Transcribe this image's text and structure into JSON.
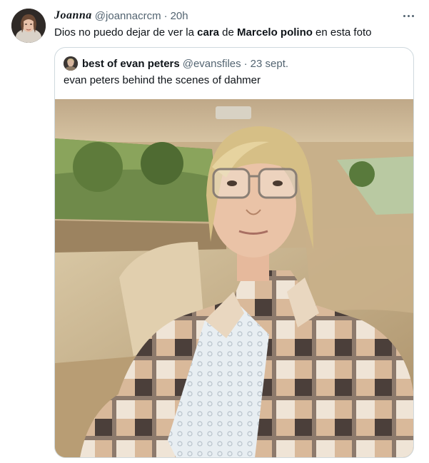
{
  "tweet": {
    "author_name": "Joanna",
    "author_handle": "@joannacrcm",
    "separator": "·",
    "time": "20h",
    "text_parts": [
      "Dios no puedo dejar de ver la ",
      "cara",
      " de ",
      "Marcelo polino",
      " en esta foto"
    ]
  },
  "quote": {
    "author_name": "best of evan peters",
    "author_handle": "@evansfiles",
    "separator": "·",
    "time": "23 sept.",
    "text": "evan peters behind the scenes of dahmer"
  },
  "icons": {
    "more": "more-horizontal-icon"
  }
}
